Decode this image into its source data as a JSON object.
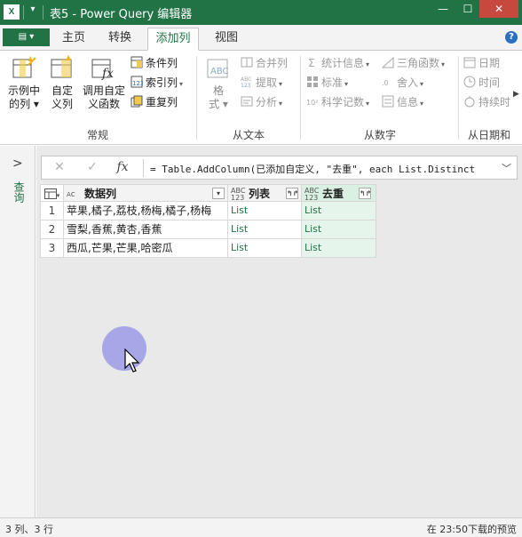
{
  "window": {
    "app_icon": "X",
    "title": "表5 - Power Query 编辑器",
    "minimize": "—",
    "maximize": "☐",
    "close": "✕"
  },
  "tabs": {
    "file_label": "▤ ▾",
    "items": [
      "主页",
      "转换",
      "添加列",
      "视图"
    ],
    "active": "添加列",
    "help": "?"
  },
  "ribbon": {
    "general": {
      "group_label": "常规",
      "example_col": [
        "示例中",
        "的列 ▾"
      ],
      "custom_col": [
        "自定",
        "义列"
      ],
      "invoke_func": [
        "调用自定",
        "义函数"
      ],
      "conditional_col": "条件列",
      "index_col": "索引列",
      "duplicate_col": "重复列"
    },
    "from_text": {
      "group_label": "从文本",
      "format": [
        "格",
        "式 ▾"
      ],
      "merge_cols": "合并列",
      "extract": "提取",
      "parse": "分析"
    },
    "from_number": {
      "group_label": "从数字",
      "statistics": "统计信息",
      "standard": "标准",
      "scientific": "科学记数",
      "trigonometry": "三角函数",
      "rounding": "舍入",
      "information": "信息"
    },
    "from_datetime": {
      "group_label": "从日期和",
      "date": "日期",
      "time": "时间",
      "duration": "持续时"
    },
    "accent_color": "#217346"
  },
  "nav": {
    "chevron": ">",
    "vertical_label": "查询"
  },
  "formula_bar": {
    "cancel": "✕",
    "confirm": "✓",
    "fx": "fx",
    "formula": "= Table.AddColumn(已添加自定义, \"去重\", each List.Distinct",
    "expand": "﹀"
  },
  "table": {
    "columns": [
      {
        "type_badge": "ABC",
        "type_badge2": "",
        "name": "数据列"
      },
      {
        "type_badge": "ABC",
        "type_badge2": "123",
        "name": "列表"
      },
      {
        "type_badge": "ABC",
        "type_badge2": "123",
        "name": "去重"
      }
    ],
    "rows": [
      {
        "n": "1",
        "data": "苹果,橘子,荔枝,杨梅,橘子,杨梅",
        "list": "List",
        "dedup": "List"
      },
      {
        "n": "2",
        "data": "雪梨,香蕉,黄杏,香蕉",
        "list": "List",
        "dedup": "List"
      },
      {
        "n": "3",
        "data": "西瓜,芒果,芒果,哈密瓜",
        "list": "List",
        "dedup": "List"
      }
    ]
  },
  "status": {
    "left": "3 列、3 行",
    "right": "在 23:50下载的预览"
  }
}
